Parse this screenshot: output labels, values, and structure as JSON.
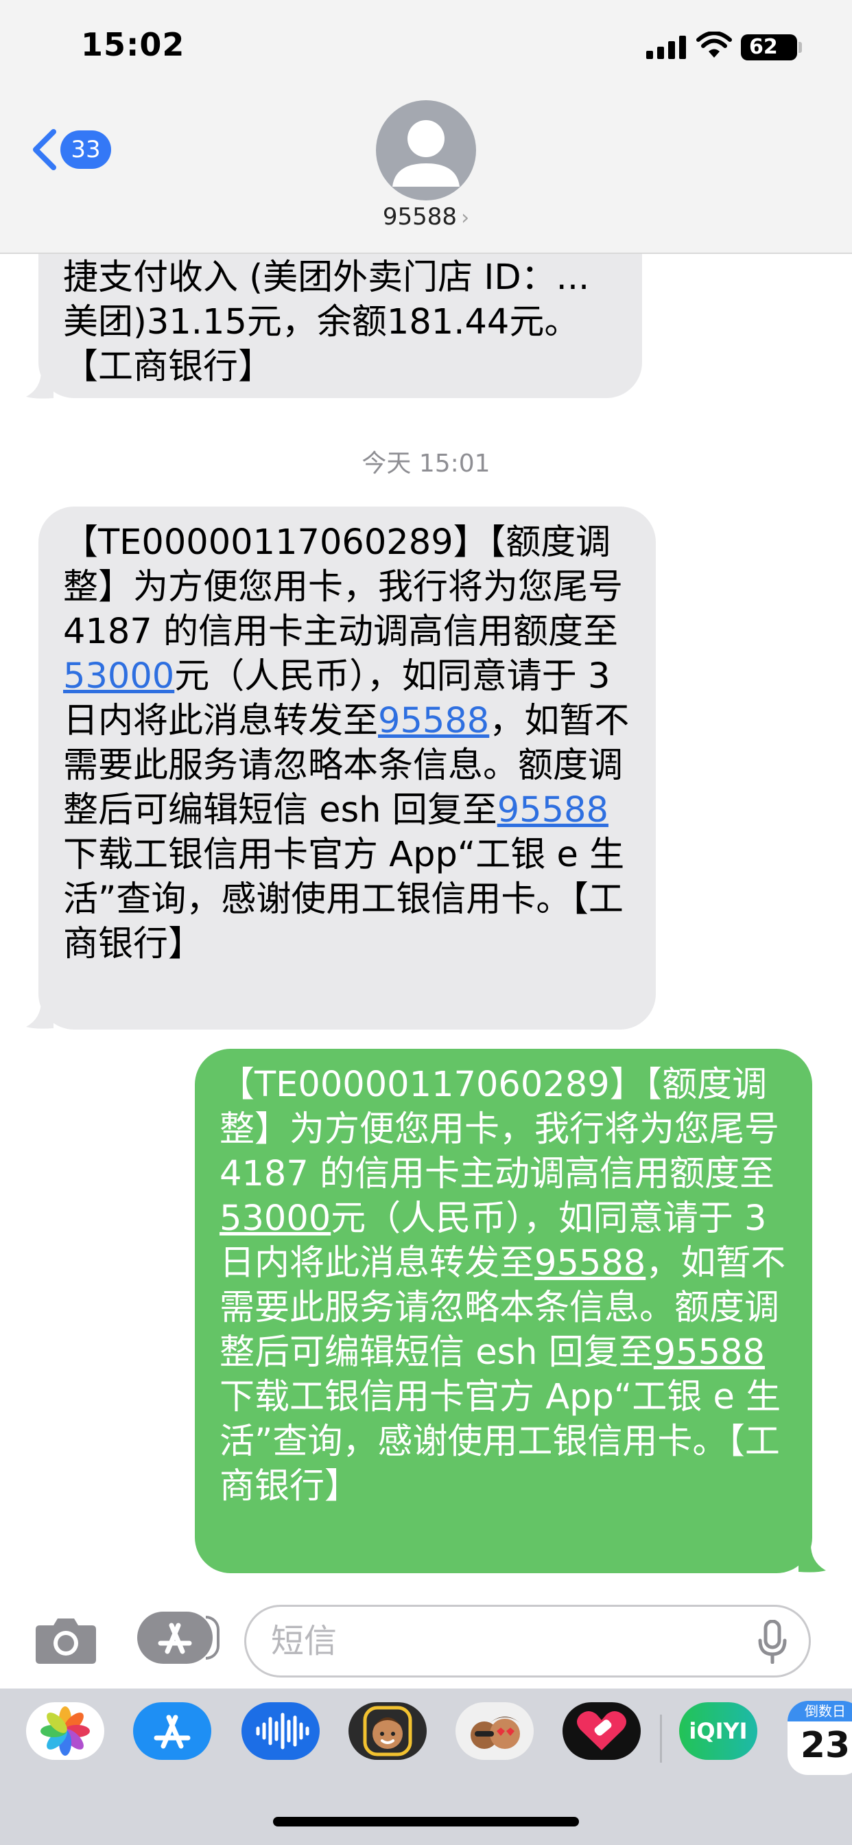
{
  "status_bar": {
    "time": "15:02",
    "battery": "62"
  },
  "nav": {
    "back_badge": "33",
    "contact": "95588"
  },
  "previous_message": {
    "line1": "捷支付收入 (美团外卖门店 ID：...",
    "line2": "美团)31.15元，余额181.44元。",
    "line3": "【工商银行】"
  },
  "timestamp": "今天 15:01",
  "incoming": {
    "p1": "【TE00000117060289】【额度调整】为方便您用卡，我行将为您尾号 4187 的信用卡主动调高信用额度至",
    "amount": "53000",
    "p2": "元（人民币），如同意请于 3 日内将此消息转发至",
    "number1": "95588",
    "p3": "，如暂不需要此服务请忽略本条信息。额度调整后可编辑短信 esh 回复至",
    "number2": "95588",
    "p4": "下载工银信用卡官方 App“工银 e 生活”查询，感谢使用工银信用卡。【工商银行】"
  },
  "outgoing": {
    "p1": "【TE00000117060289】【额度调整】为方便您用卡，我行将为您尾号 4187 的信用卡主动调高信用额度至",
    "amount": "53000",
    "p2": "元（人民币），如同意请于 3 日内将此消息转发至",
    "number1": "95588",
    "p3": "，如暂不需要此服务请忽略本条信息。额度调整后可编辑短信 esh 回复至",
    "number2": "95588",
    "p4": "下载工银信用卡官方 App“工银 e 生活”查询，感谢使用工银信用卡。【工商银行】"
  },
  "input": {
    "placeholder": "短信"
  },
  "app_drawer": {
    "apps": [
      "photos-icon",
      "app-store-icon",
      "audio-icon",
      "memoji-icon",
      "memoji-stickers-icon",
      "heart-app-icon",
      "iqiyi-icon",
      "countdown-icon"
    ],
    "iqiyi_label": "iQIYI",
    "countdown_label": "倒数日",
    "countdown_value": "23"
  },
  "colors": {
    "accent": "#3478f6",
    "outgoing_bubble": "#64c466",
    "incoming_bubble": "#e9e9eb",
    "link": "#2e6fe0"
  }
}
